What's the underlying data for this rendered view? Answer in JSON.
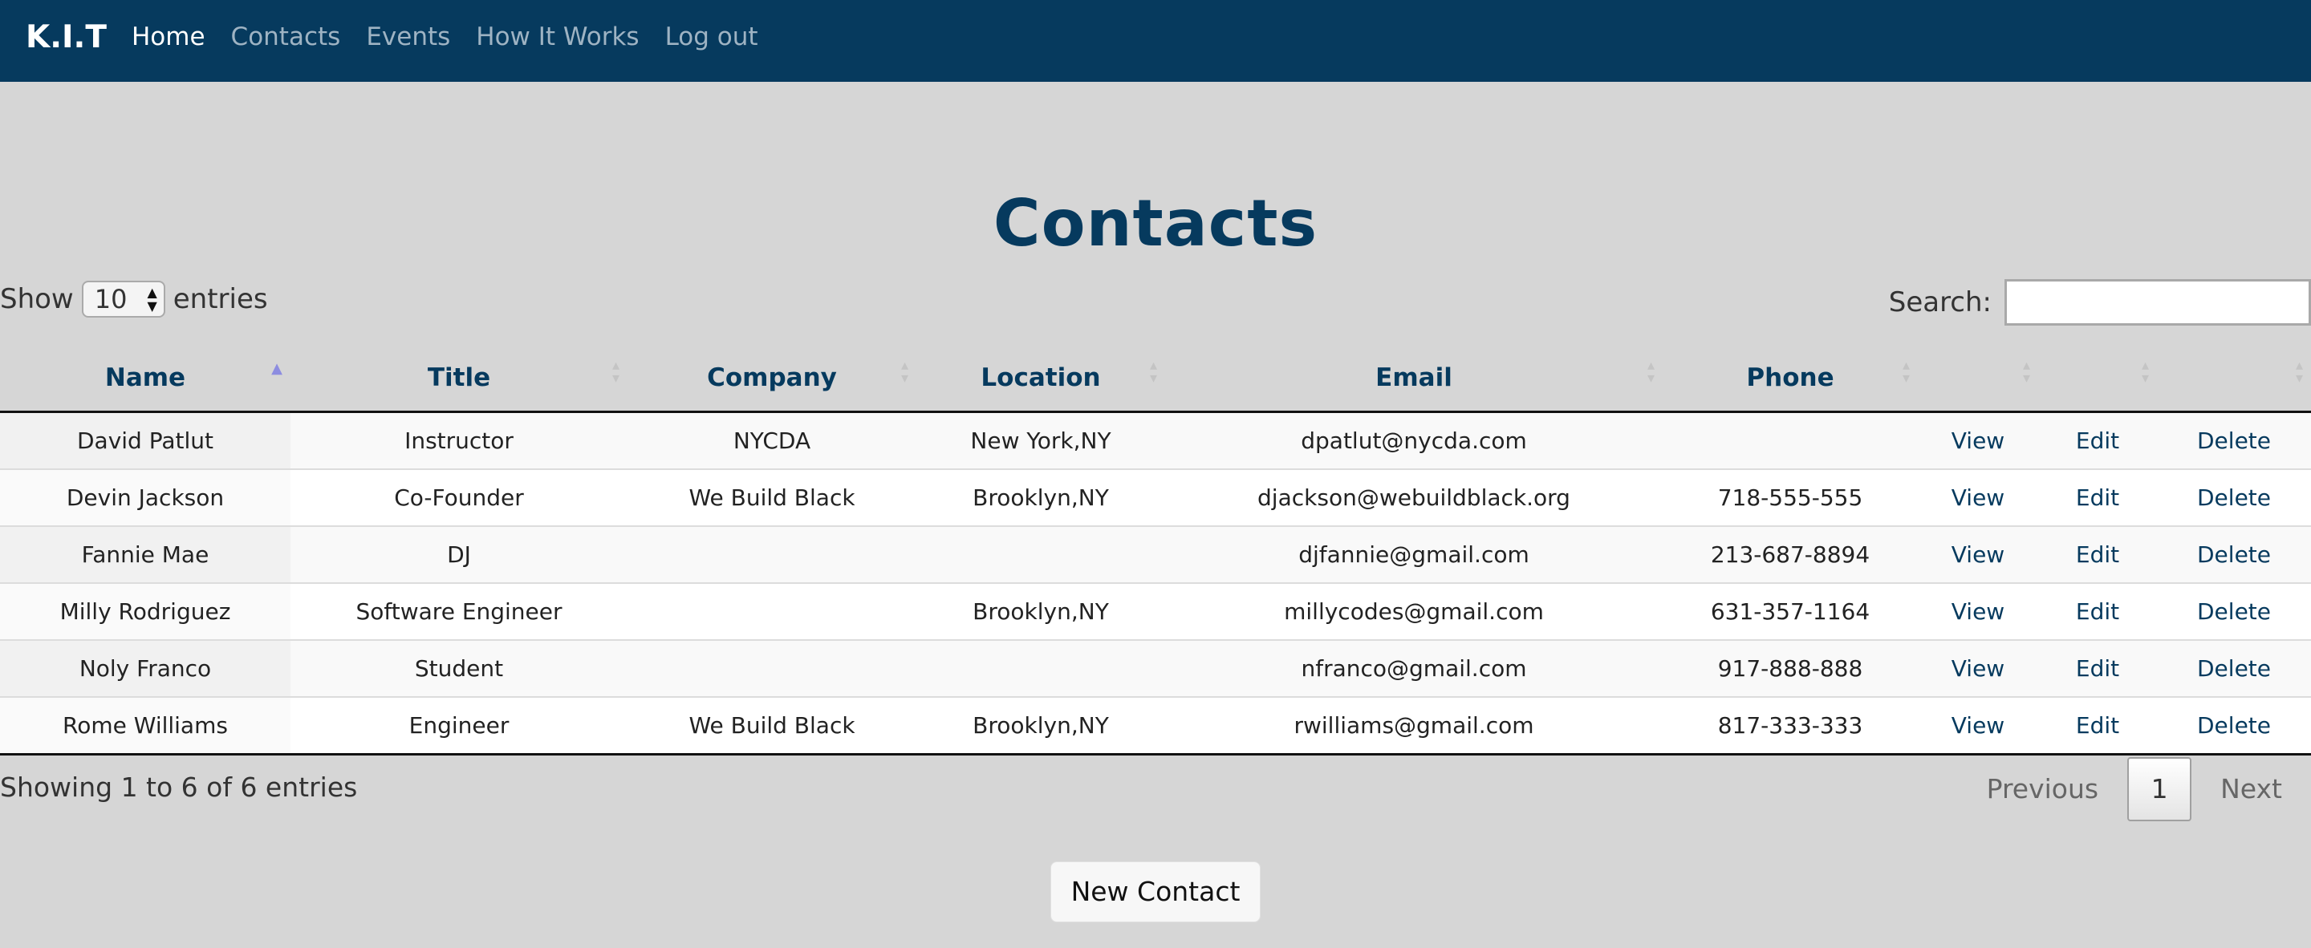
{
  "nav": {
    "brand": "K.I.T",
    "items": [
      {
        "label": "Home",
        "active": true
      },
      {
        "label": "Contacts",
        "active": false
      },
      {
        "label": "Events",
        "active": false
      },
      {
        "label": "How It Works",
        "active": false
      },
      {
        "label": "Log out",
        "active": false
      }
    ]
  },
  "page": {
    "title": "Contacts"
  },
  "length": {
    "prefix": "Show",
    "value": "10",
    "suffix": "entries"
  },
  "search": {
    "label": "Search:",
    "value": "",
    "placeholder": ""
  },
  "table": {
    "columns": [
      "Name",
      "Title",
      "Company",
      "Location",
      "Email",
      "Phone",
      "",
      "",
      ""
    ],
    "sorted_column": "Name",
    "rows": [
      {
        "name": "David Patlut",
        "title": "Instructor",
        "company": "NYCDA",
        "location": "New York,NY",
        "email": "dpatlut@nycda.com",
        "phone": "",
        "view": "View",
        "edit": "Edit",
        "delete": "Delete"
      },
      {
        "name": "Devin Jackson",
        "title": "Co-Founder",
        "company": "We Build Black",
        "location": "Brooklyn,NY",
        "email": "djackson@webuildblack.org",
        "phone": "718-555-555",
        "view": "View",
        "edit": "Edit",
        "delete": "Delete"
      },
      {
        "name": "Fannie Mae",
        "title": "DJ",
        "company": "",
        "location": "",
        "email": "djfannie@gmail.com",
        "phone": "213-687-8894",
        "view": "View",
        "edit": "Edit",
        "delete": "Delete"
      },
      {
        "name": "Milly Rodriguez",
        "title": "Software Engineer",
        "company": "",
        "location": "Brooklyn,NY",
        "email": "millycodes@gmail.com",
        "phone": "631-357-1164",
        "view": "View",
        "edit": "Edit",
        "delete": "Delete"
      },
      {
        "name": "Noly Franco",
        "title": "Student",
        "company": "",
        "location": "",
        "email": "nfranco@gmail.com",
        "phone": "917-888-888",
        "view": "View",
        "edit": "Edit",
        "delete": "Delete"
      },
      {
        "name": "Rome Williams",
        "title": "Engineer",
        "company": "We Build Black",
        "location": "Brooklyn,NY",
        "email": "rwilliams@gmail.com",
        "phone": "817-333-333",
        "view": "View",
        "edit": "Edit",
        "delete": "Delete"
      }
    ]
  },
  "footer": {
    "info": "Showing 1 to 6 of 6 entries",
    "previous": "Previous",
    "current_page": "1",
    "next": "Next",
    "new_contact": "New Contact"
  },
  "colors": {
    "navbar": "#063a5e",
    "title": "#063a5e",
    "background": "#d6d6d6",
    "link": "#063a5e"
  }
}
